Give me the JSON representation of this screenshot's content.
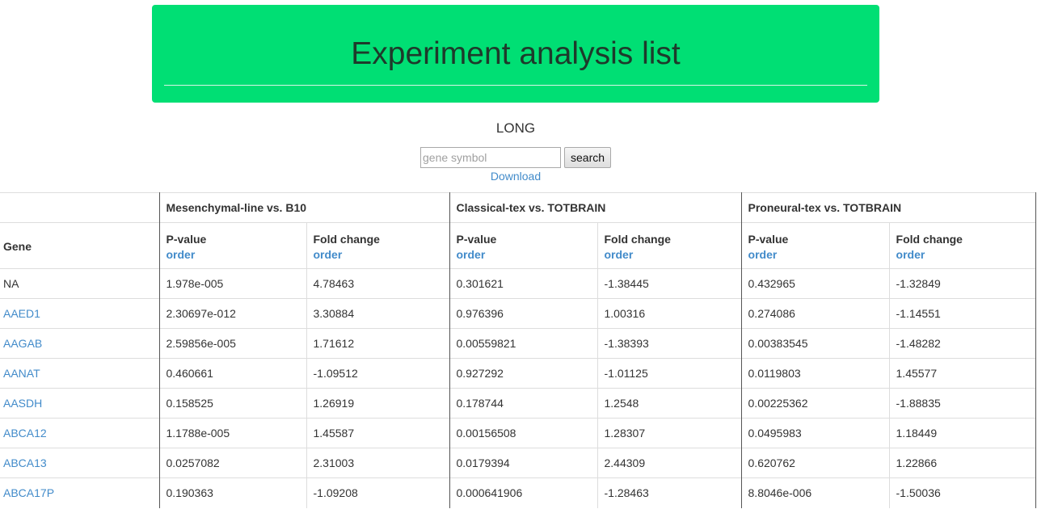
{
  "banner": {
    "title": "Experiment analysis list"
  },
  "subtitle": "LONG",
  "search": {
    "placeholder": "gene symbol",
    "value": "",
    "button_label": "search"
  },
  "download_label": "Download",
  "table": {
    "gene_header": "Gene",
    "groups": [
      {
        "label": "Mesenchymal-line vs. B10"
      },
      {
        "label": "Classical-tex vs. TOTBRAIN"
      },
      {
        "label": "Proneural-tex vs. TOTBRAIN"
      }
    ],
    "sub_headers": {
      "pvalue": "P-value",
      "fold": "Fold change",
      "order": "order"
    },
    "rows": [
      {
        "gene": "NA",
        "linked": false,
        "values": [
          "1.978e-005",
          "4.78463",
          "0.301621",
          "-1.38445",
          "0.432965",
          "-1.32849"
        ]
      },
      {
        "gene": "AAED1",
        "linked": true,
        "values": [
          "2.30697e-012",
          "3.30884",
          "0.976396",
          "1.00316",
          "0.274086",
          "-1.14551"
        ]
      },
      {
        "gene": "AAGAB",
        "linked": true,
        "values": [
          "2.59856e-005",
          "1.71612",
          "0.00559821",
          "-1.38393",
          "0.00383545",
          "-1.48282"
        ]
      },
      {
        "gene": "AANAT",
        "linked": true,
        "values": [
          "0.460661",
          "-1.09512",
          "0.927292",
          "-1.01125",
          "0.0119803",
          "1.45577"
        ]
      },
      {
        "gene": "AASDH",
        "linked": true,
        "values": [
          "0.158525",
          "1.26919",
          "0.178744",
          "1.2548",
          "0.00225362",
          "-1.88835"
        ]
      },
      {
        "gene": "ABCA12",
        "linked": true,
        "values": [
          "1.1788e-005",
          "1.45587",
          "0.00156508",
          "1.28307",
          "0.0495983",
          "1.18449"
        ]
      },
      {
        "gene": "ABCA13",
        "linked": true,
        "values": [
          "0.0257082",
          "2.31003",
          "0.0179394",
          "2.44309",
          "0.620762",
          "1.22866"
        ]
      },
      {
        "gene": "ABCA17P",
        "linked": true,
        "values": [
          "0.190363",
          "-1.09208",
          "0.000641906",
          "-1.28463",
          "8.8046e-006",
          "-1.50036"
        ]
      }
    ]
  },
  "colors": {
    "banner": "#00df74",
    "link": "#428bca",
    "text": "#333333"
  }
}
